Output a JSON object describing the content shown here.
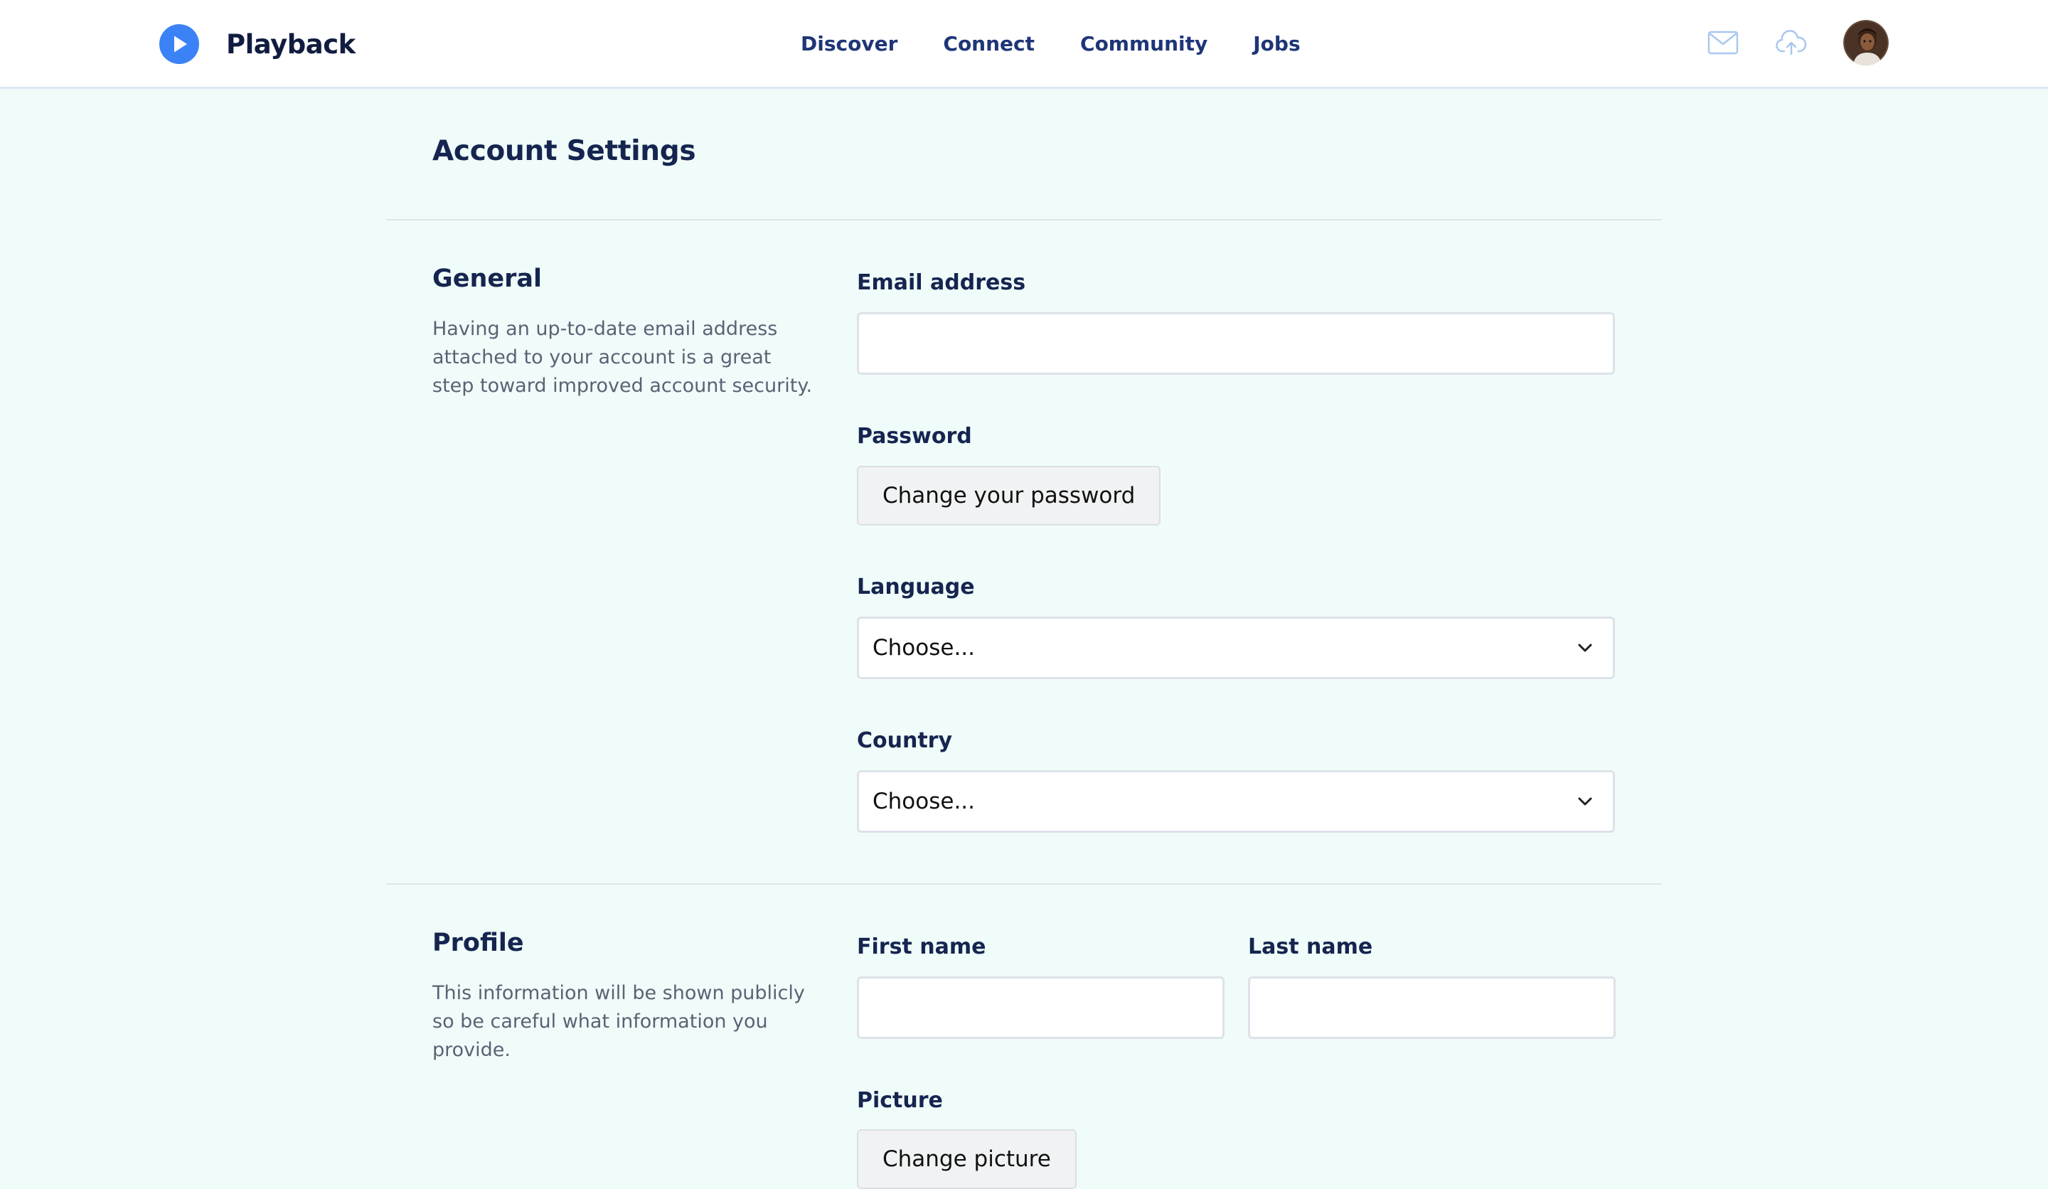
{
  "brand": {
    "name": "Playback",
    "color": "#3b82f6"
  },
  "nav": {
    "items": [
      {
        "label": "Discover"
      },
      {
        "label": "Connect"
      },
      {
        "label": "Community"
      },
      {
        "label": "Jobs"
      }
    ]
  },
  "header_actions": {
    "icons": [
      "mail-icon",
      "cloud-upload-icon"
    ],
    "avatar": "user-avatar"
  },
  "page": {
    "title": "Account Settings"
  },
  "general": {
    "title": "General",
    "description": "Having an up-to-date email address attached to your account is a great step toward improved account security.",
    "email_label": "Email address",
    "email_value": "",
    "password_label": "Password",
    "change_password_label": "Change your password",
    "language_label": "Language",
    "language_value": "Choose...",
    "country_label": "Country",
    "country_value": "Choose..."
  },
  "profile": {
    "title": "Profile",
    "description": "This information will be shown publicly so be careful what information you provide.",
    "first_name_label": "First name",
    "first_name_value": "",
    "last_name_label": "Last name",
    "last_name_value": "",
    "picture_label": "Picture",
    "change_picture_label": "Change picture"
  },
  "colors": {
    "background": "#f0fcf9",
    "text_primary": "#152550",
    "nav_text": "#1e3577",
    "accent": "#3b82f6"
  }
}
